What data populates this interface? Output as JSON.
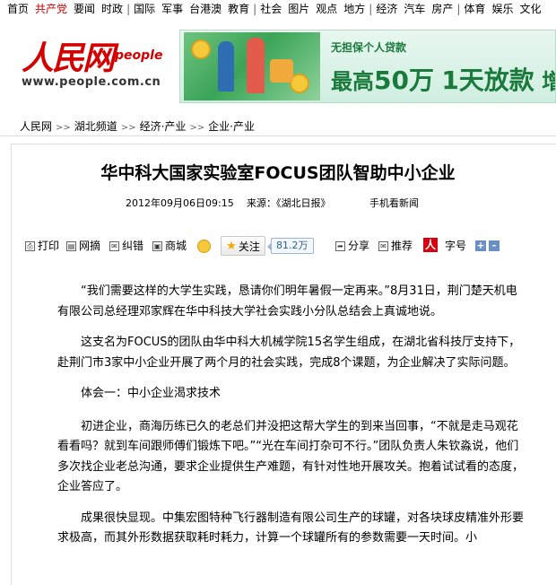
{
  "topnav": {
    "groups": [
      [
        "首页",
        "共产党",
        "要闻",
        "时政"
      ],
      [
        "国际",
        "军事",
        "台港澳",
        "教育"
      ],
      [
        "社会",
        "图片",
        "观点",
        "地方"
      ],
      [
        "经济",
        "汽车",
        "房产"
      ],
      [
        "体育",
        "娱乐",
        "文化"
      ]
    ],
    "highlight": "共产党"
  },
  "logo": {
    "cn": "人民网",
    "en": "people",
    "url": "www.people.com.cn"
  },
  "ad": {
    "line1": "无担保个人贷款",
    "line2_prefix": "最高",
    "line2_amount": "50万",
    "line2_mid": "1天放款",
    "line2_tail": "增值"
  },
  "breadcrumb": {
    "items": [
      "人民网",
      "湖北频道",
      "经济·产业",
      "企业·产业"
    ],
    "separator": ">>"
  },
  "article": {
    "title": "华中科大国家实验室FOCUS团队智助中小企业",
    "date": "2012年09月06日09:15",
    "source": "来源：《湖北日报》",
    "mobile": "手机看新闻",
    "paragraphs": [
      "“我们需要这样的大学生实践，恳请你们明年暑假一定再来。”8月31日，荆门楚天机电有限公司总经理邓家辉在华中科技大学社会实践小分队总结会上真诚地说。",
      "这支名为FOCUS的团队由华中科大机械学院15名学生组成，在湖北省科技厅支持下，赴荆门市3家中小企业开展了两个月的社会实践，完成8个课题，为企业解决了实际问题。",
      "体会一：中小企业渴求技术",
      "初进企业，商海历练已久的老总们并没把这帮大学生的到来当回事，“不就是走马观花看看吗？就到车间跟师傅们锻炼下吧。”“光在车间打杂可不行。”团队负责人朱钦淼说，他们多次找企业老总沟通，要求企业提供生产难题，有针对性地开展攻关。抱着试试看的态度，企业答应了。",
      "成果很快显现。中集宏图特种飞行器制造有限公司生产的球罐，对各块球皮精准外形要求极高，而其外形数据获取耗时耗力，计算一个球罐所有的参数需要一天时间。小"
    ]
  },
  "toolbar": {
    "print": "打印",
    "wangzhai": "网摘",
    "jiucuo": "纠错",
    "shangcheng": "商城",
    "follow": "关注",
    "follow_count": "81.2万",
    "share": "分享",
    "recommend": "推荐",
    "renren_glyph": "人",
    "font_size": "字号",
    "zoom_in": "+",
    "zoom_out": "-"
  }
}
